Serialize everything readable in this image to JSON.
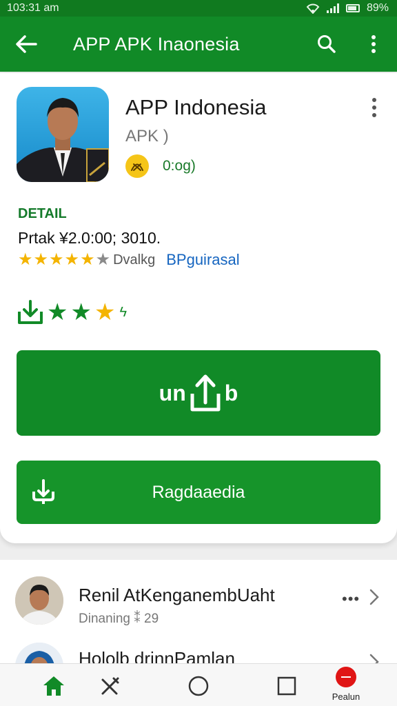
{
  "status_bar": {
    "time": "103:31 am",
    "battery": "89%"
  },
  "app_bar": {
    "title": "APP APK Inaonesia",
    "back_icon": "arrow-left-icon",
    "search_icon": "search-icon",
    "more_icon": "more-vertical-icon"
  },
  "app": {
    "name": "APP Indonesia",
    "subtitle": "APK )",
    "badge_text": "0:og)",
    "detail_label": "DETAIL",
    "price_line": "Prtak ¥2.0:00; 3010.",
    "stars_filled": 5,
    "stars_empty": 1,
    "rating_label": "Dvalkg",
    "rating_link": "BPguirasal",
    "mini_half_symbol": "ϟ"
  },
  "buttons": {
    "primary_left": "un",
    "primary_right": "b",
    "secondary": "Ragdaaedia"
  },
  "list": {
    "items": [
      {
        "title": "Renil AtKenganembUaht",
        "subtitle": "Dinaning ⁑ 29",
        "more": "•••"
      },
      {
        "title": "Hololb drinnPamlan"
      }
    ]
  },
  "bottom_nav": {
    "home_icon": "home-icon",
    "tools_icon": "tools-icon",
    "circle_icon": "circle-icon",
    "square_icon": "square-icon",
    "record_label": "Pealun"
  },
  "colors": {
    "primary_green": "#118a27",
    "status_green": "#107a1f",
    "star_gold": "#f4b400",
    "link_blue": "#1565c0",
    "record_red": "#e01515"
  }
}
